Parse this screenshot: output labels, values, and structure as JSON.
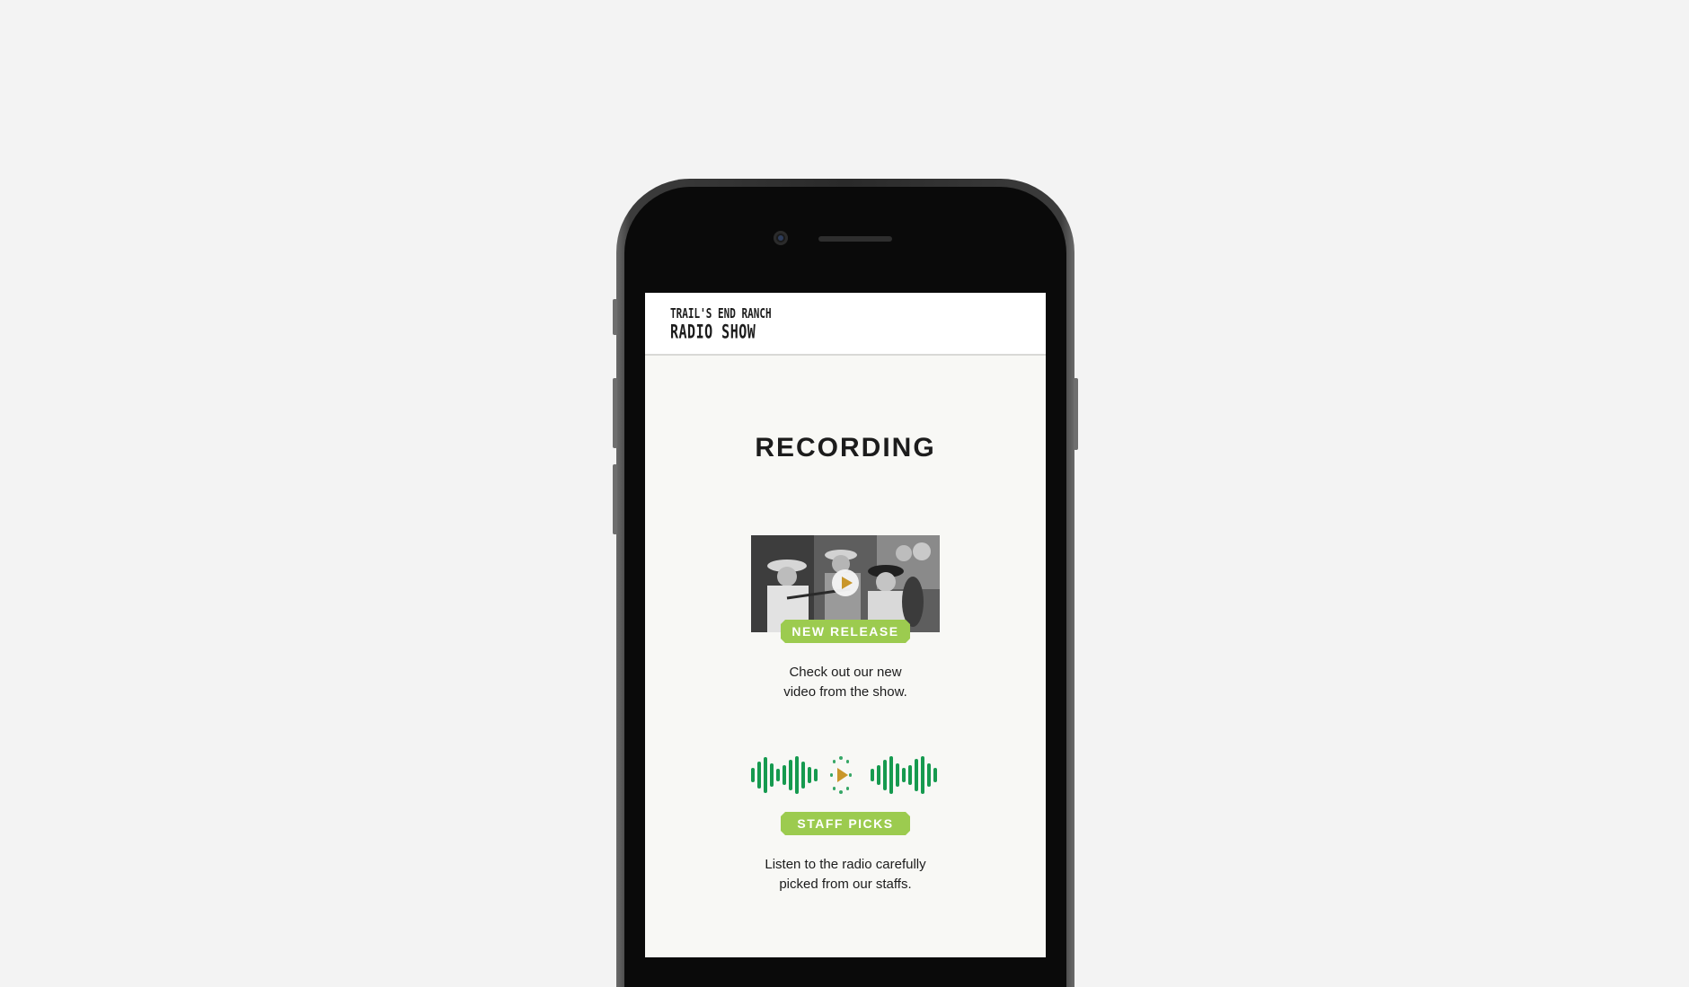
{
  "app": {
    "logo_line1": "TRAIL'S END RANCH",
    "logo_line2": "RADIO SHOW"
  },
  "page": {
    "title": "RECORDING"
  },
  "sections": [
    {
      "badge": "NEW RELEASE",
      "description_line1": "Check out our new",
      "description_line2": "video from the show."
    },
    {
      "badge": "STAFF PICKS",
      "description_line1": "Listen to the radio carefully",
      "description_line2": "picked from our staffs."
    }
  ],
  "colors": {
    "badge": "#9ccb4f",
    "waveform": "#169a4f",
    "play_accent": "#c9962a"
  }
}
